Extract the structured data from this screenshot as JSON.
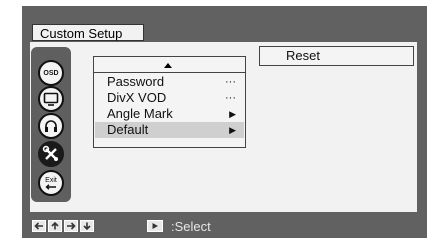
{
  "header": {
    "title": "Custom Setup"
  },
  "sidebar": {
    "icons": [
      {
        "name": "osd-icon",
        "label": "OSD"
      },
      {
        "name": "monitor-icon"
      },
      {
        "name": "headphones-icon"
      },
      {
        "name": "tools-icon",
        "active": true
      },
      {
        "name": "exit-icon",
        "label": "Exit"
      }
    ]
  },
  "menu": {
    "items": [
      {
        "label": "Password",
        "indicator": "···"
      },
      {
        "label": "DivX VOD",
        "indicator": "···"
      },
      {
        "label": "Angle Mark",
        "indicator": "▶"
      },
      {
        "label": "Default",
        "indicator": "▶",
        "selected": true
      }
    ]
  },
  "submenu": {
    "reset_label": "Reset"
  },
  "footer": {
    "select_label": ":Select"
  },
  "colors": {
    "background": "#616161",
    "panel": "#f2f2f2",
    "selected": "#cfcfcf"
  }
}
